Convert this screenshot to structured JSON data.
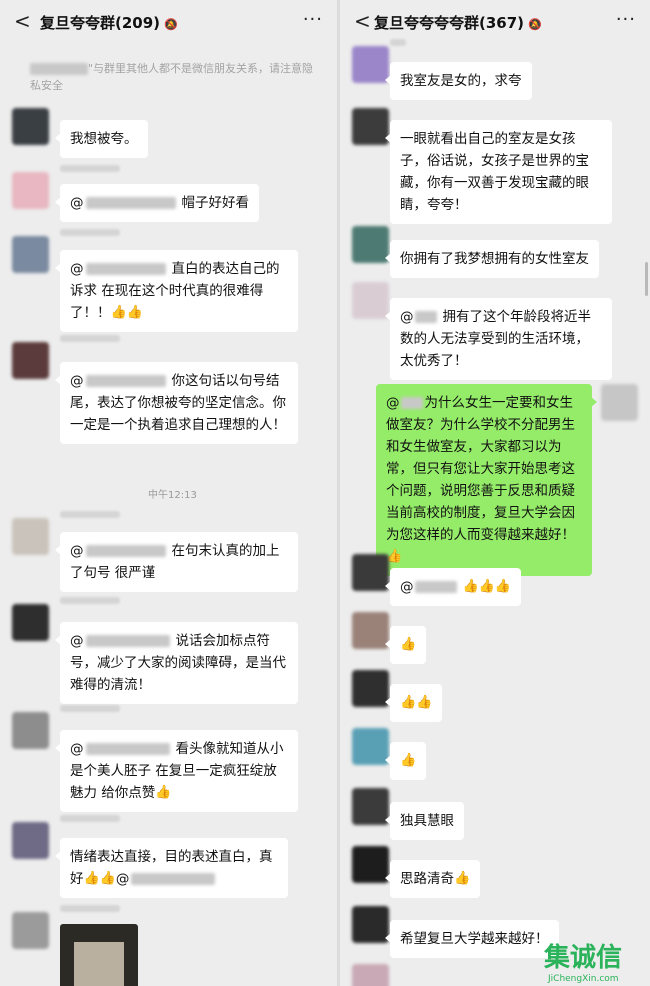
{
  "colors": {
    "accent_green": "#95ec69",
    "background": "#ededed",
    "bubble_white": "#ffffff",
    "watermark": "#2ab35a"
  },
  "icons": {
    "back": "chevron-left-icon",
    "mute": "bell-off-icon",
    "more": "more-dots-icon",
    "thumb": "thumbs-up-emoji"
  },
  "left": {
    "header": {
      "back": "<",
      "title": "复旦夸夸群(209)",
      "mute": "🔕",
      "more": "···"
    },
    "notice": "\"与群里其他人都不是微信朋友关系，请注意隐私安全",
    "time": "中午12:13",
    "messages": [
      {
        "text": "我想被夸。"
      },
      {
        "at": "@",
        "text": "帽子好好看"
      },
      {
        "at": "@",
        "text": "直白的表达自己的诉求 在现在这个时代真的很难得了！！",
        "thumbs": "👍👍"
      },
      {
        "at": "@",
        "text": "你这句话以句号结尾，表达了你想被夸的坚定信念。你一定是一个执着追求自己理想的人！"
      },
      {
        "at": "@",
        "text": "在句末认真的加上了句号 很严谨"
      },
      {
        "at": "@",
        "text": "说话会加标点符号，减少了大家的阅读障碍，是当代难得的清流！"
      },
      {
        "at": "@",
        "text": "看头像就知道从小是个美人胚子 在复旦一定疯狂绽放魅力 给你点赞",
        "thumbs": "👍"
      },
      {
        "text": "情绪表达直接，目的表述直白，真好",
        "thumbs": "👍👍",
        "at_end": "@"
      }
    ]
  },
  "right": {
    "header": {
      "back": "<",
      "title": "复旦夸夸夸夸群(367)",
      "mute": "🔕",
      "more": "···"
    },
    "messages": [
      {
        "text": "我室友是女的，求夸"
      },
      {
        "text": "一眼就看出自己的室友是女孩子，俗话说，女孩子是世界的宝藏，你有一双善于发现宝藏的眼睛，夸夸！"
      },
      {
        "text": "你拥有了我梦想拥有的女性室友"
      },
      {
        "at": "@",
        "text": "拥有了这个年龄段将近半数的人无法享受到的生活环境，太优秀了！"
      },
      {
        "at": "@",
        "text": "为什么女生一定要和女生做室友？为什么学校不分配男生和女生做室友，大家都习以为常，但只有您让大家开始思考这个问题，说明您善于反思和质疑当前高校的制度，复旦大学会因为您这样的人而变得越来越好！",
        "thumbs": "👍"
      },
      {
        "at": "@",
        "thumbs": "👍👍👍"
      },
      {
        "thumbs": "👍"
      },
      {
        "thumbs": "👍👍"
      },
      {
        "thumbs": "👍"
      },
      {
        "text": "独具慧眼"
      },
      {
        "text": "思路清奇",
        "thumbs": "👍"
      },
      {
        "text": "希望复旦大学越来越好！"
      }
    ]
  },
  "watermark": {
    "logo": "集诚信",
    "url": "JiChengXin.com"
  }
}
